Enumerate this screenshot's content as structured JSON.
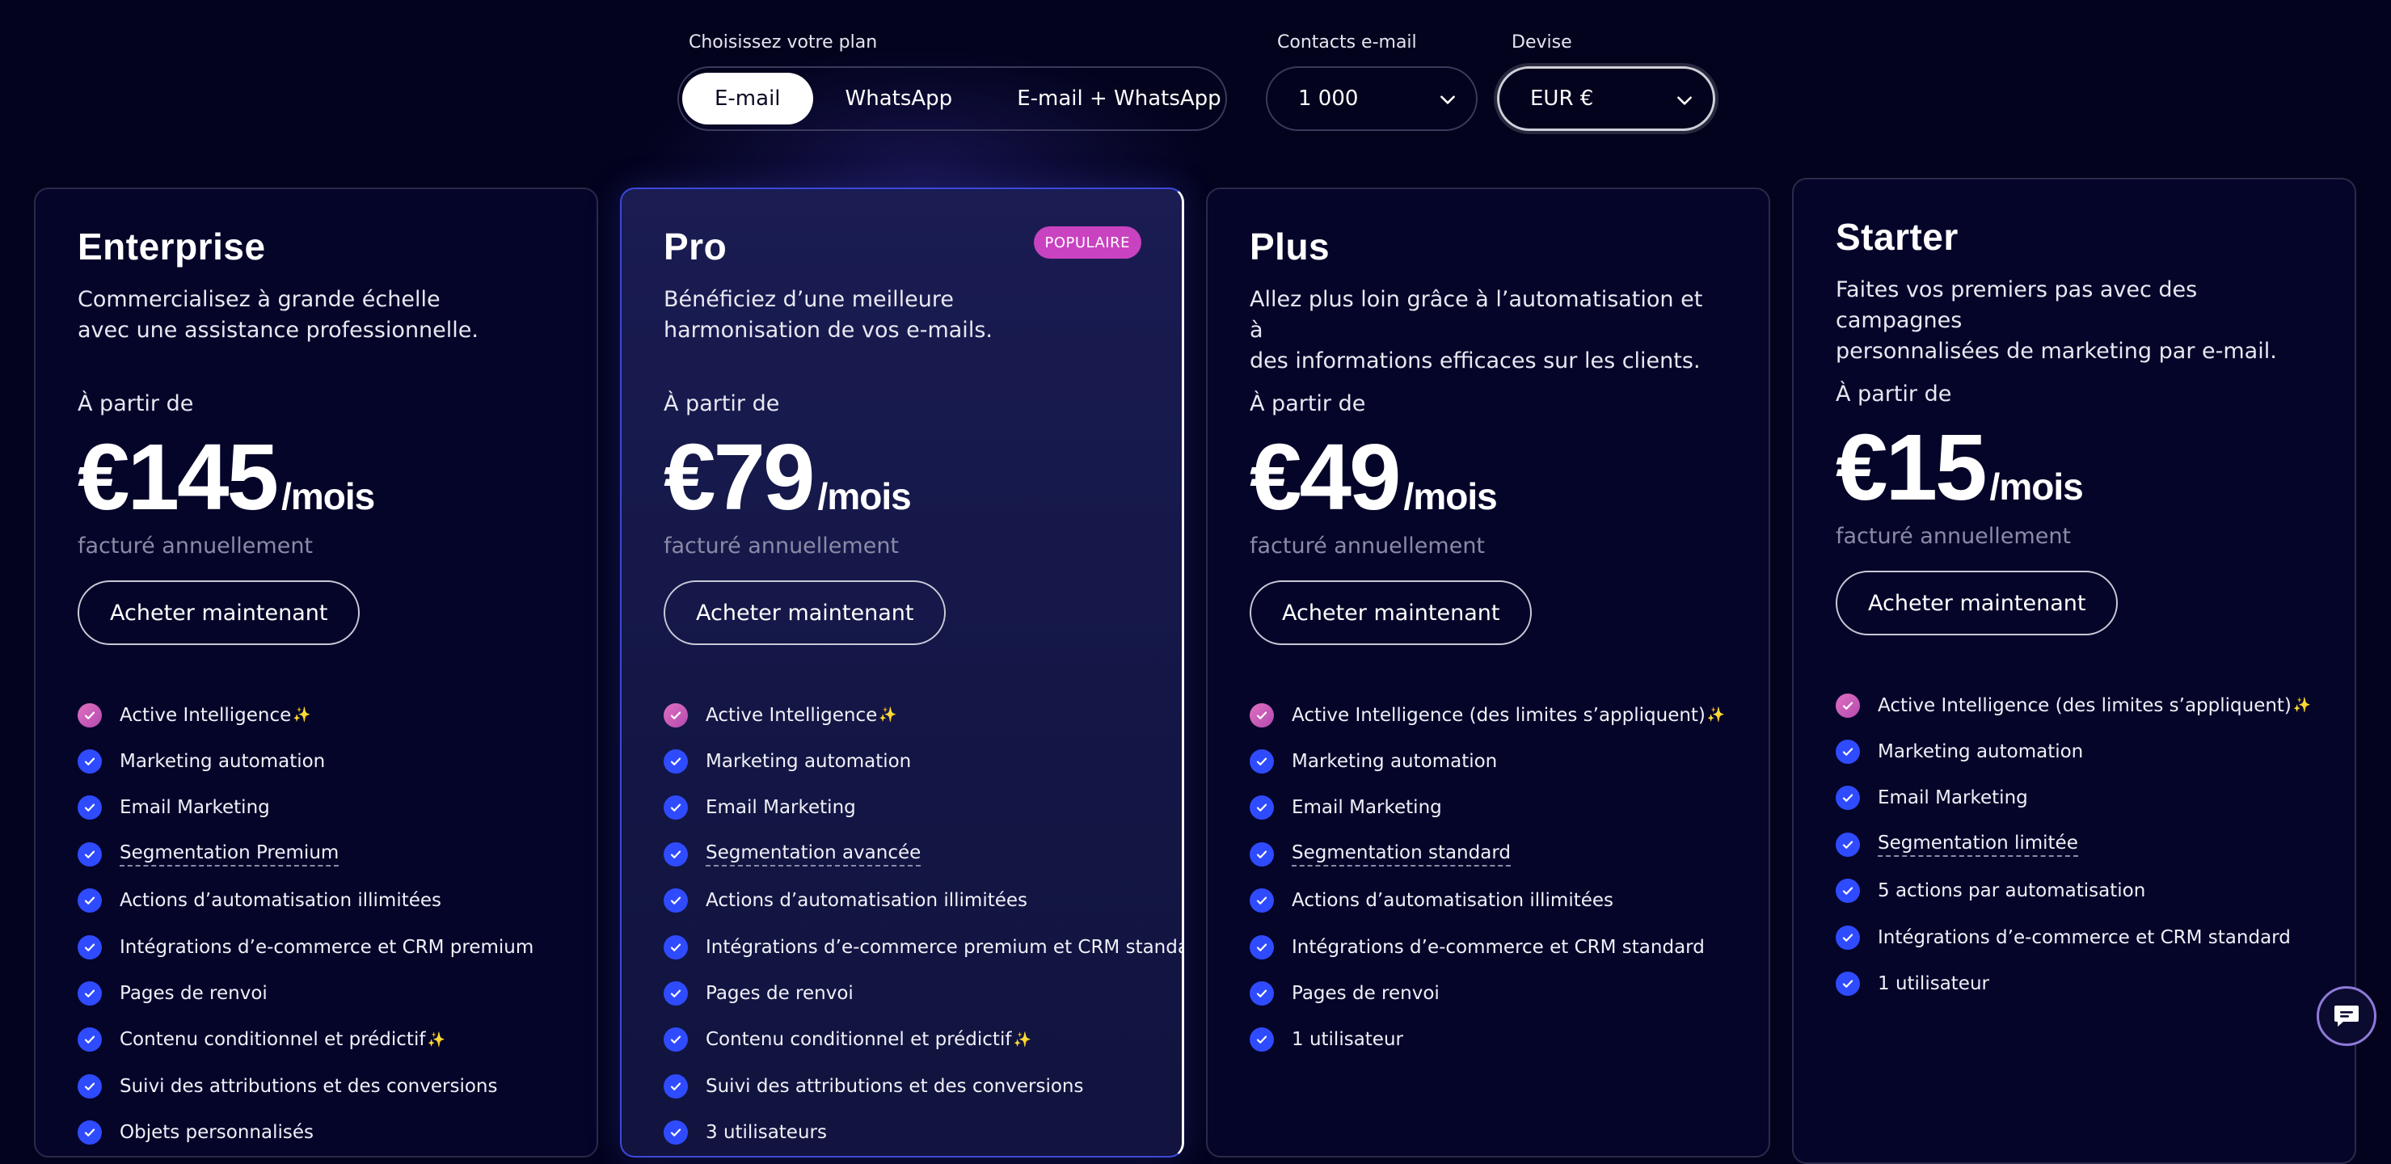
{
  "controls": {
    "plan_label": "Choisissez votre plan",
    "plans": [
      "E-mail",
      "WhatsApp",
      "E-mail + WhatsApp"
    ],
    "contacts_label": "Contacts e-mail",
    "contacts_value": "1 000",
    "currency_label": "Devise",
    "currency_value": "EUR €"
  },
  "cards": [
    {
      "name": "Enterprise",
      "desc_line1": "Commercialisez à grande échelle",
      "desc_line2": "avec une assistance professionnelle.",
      "from": "À partir de",
      "price": "€145",
      "per": "/mois",
      "billed": "facturé annuellement",
      "cta": "Acheter maintenant",
      "features": [
        "Active Intelligence",
        "Marketing automation",
        "Email Marketing",
        "Segmentation Premium",
        "Actions d’automatisation illimitées",
        "Intégrations d’e-commerce et CRM premium",
        "Pages de renvoi",
        "Contenu conditionnel et prédictif",
        "Suivi des attributions et des conversions",
        "Objets personnalisés"
      ]
    },
    {
      "name": "Pro",
      "badge": "POPULAIRE",
      "desc_line1": "Bénéficiez d’une meilleure",
      "desc_line2": "harmonisation de vos e-mails.",
      "from": "À partir de",
      "price": "€79",
      "per": "/mois",
      "billed": "facturé annuellement",
      "cta": "Acheter maintenant",
      "features": [
        "Active Intelligence",
        "Marketing automation",
        "Email Marketing",
        "Segmentation avancée",
        "Actions d’automatisation illimitées",
        "Intégrations d’e-commerce premium et CRM standard",
        "Pages de renvoi",
        "Contenu conditionnel et prédictif",
        "Suivi des attributions et des conversions",
        "3 utilisateurs"
      ]
    },
    {
      "name": "Plus",
      "desc_line1": "Allez plus loin grâce à l’automatisation et à",
      "desc_line2": "des informations efficaces sur les clients.",
      "from": "À partir de",
      "price": "€49",
      "per": "/mois",
      "billed": "facturé annuellement",
      "cta": "Acheter maintenant",
      "features": [
        "Active Intelligence (des limites s’appliquent)",
        "Marketing automation",
        "Email Marketing",
        "Segmentation standard",
        "Actions d’automatisation illimitées",
        "Intégrations d’e-commerce et CRM standard",
        "Pages de renvoi",
        "1 utilisateur"
      ]
    },
    {
      "name": "Starter",
      "desc_line1": "Faites vos premiers pas avec des campagnes",
      "desc_line2": "personnalisées de marketing par e-mail.",
      "from": "À partir de",
      "price": "€15",
      "per": "/mois",
      "billed": "facturé annuellement",
      "cta": "Acheter maintenant",
      "features": [
        "Active Intelligence (des limites s’appliquent)",
        "Marketing automation",
        "Email Marketing",
        "Segmentation limitée",
        "5 actions par automatisation",
        "Intégrations d’e-commerce et CRM standard",
        "1 utilisateur"
      ]
    }
  ],
  "icons": {
    "chevron": "chevron-down-icon",
    "check": "check-circle-icon",
    "sparkle": "sparkle-icon",
    "chat": "chat-bubble-icon"
  },
  "colors": {
    "background": "#03031e",
    "accent_blue": "#2f4bff",
    "badge_pink": "#c942c0"
  }
}
